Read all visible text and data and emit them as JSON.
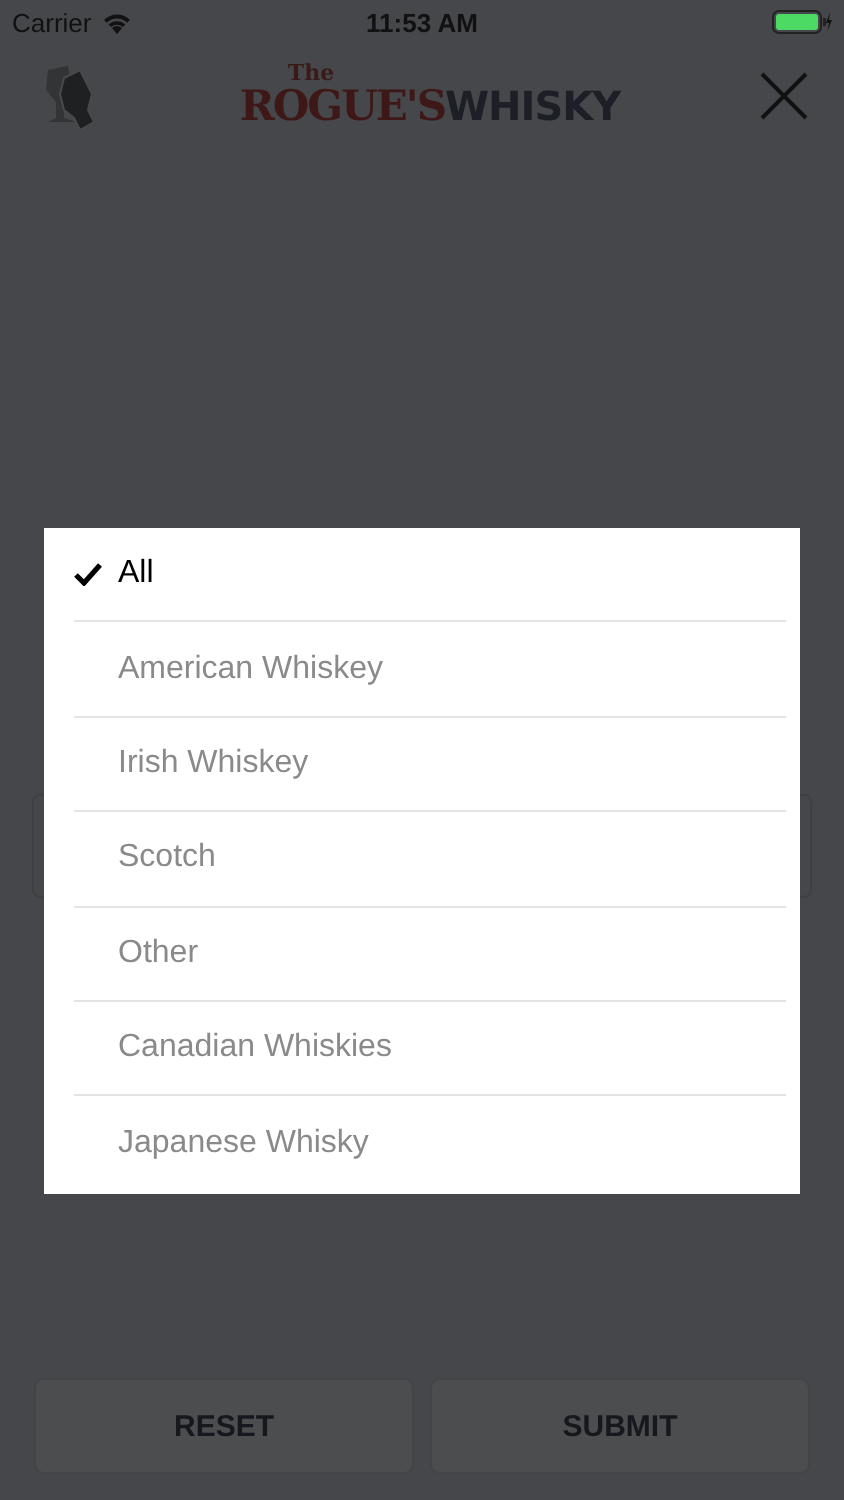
{
  "status_bar": {
    "carrier": "Carrier",
    "time": "11:53 AM"
  },
  "header": {
    "logo": {
      "prefix": "The",
      "first": "ROGUE'S",
      "second": "WHISKY"
    }
  },
  "picker": {
    "options": [
      {
        "label": "All",
        "selected": true
      },
      {
        "label": "American Whiskey",
        "selected": false
      },
      {
        "label": "Irish Whiskey",
        "selected": false
      },
      {
        "label": "Scotch",
        "selected": false
      },
      {
        "label": "Other",
        "selected": false
      },
      {
        "label": "Canadian Whiskies",
        "selected": false
      },
      {
        "label": "Japanese Whisky",
        "selected": false
      }
    ]
  },
  "buttons": [
    {
      "label": "RESET"
    },
    {
      "label": "SUBMIT"
    }
  ]
}
